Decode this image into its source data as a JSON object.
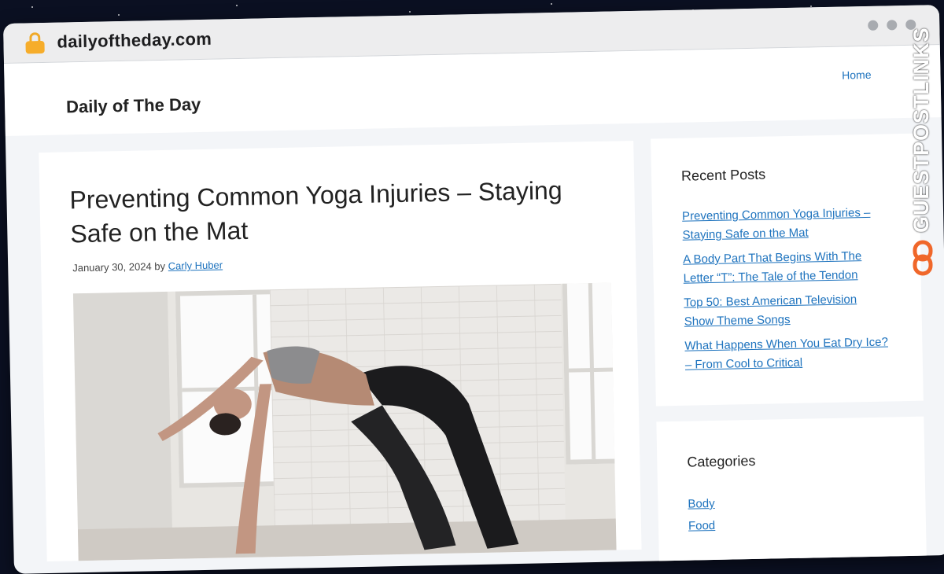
{
  "browser": {
    "url": "dailyoftheday.com"
  },
  "header": {
    "site_title": "Daily of The Day",
    "nav_home": "Home"
  },
  "article": {
    "title": "Preventing Common Yoga Injuries – Staying Safe on the Mat",
    "date": "January 30, 2024",
    "by": "by",
    "author": "Carly Huber"
  },
  "sidebar": {
    "recent_title": "Recent Posts",
    "recent_posts": [
      "Preventing Common Yoga Injuries – Staying Safe on the Mat",
      "A Body Part That Begins With The Letter “T”: The Tale of the Tendon",
      "Top 50: Best American Television Show Theme Songs",
      "What Happens When You Eat Dry Ice? – From Cool to Critical"
    ],
    "categories_title": "Categories",
    "categories": [
      "Body",
      "Food"
    ]
  },
  "watermark": {
    "text": "GUESTPOSTLINKS"
  },
  "colors": {
    "link": "#1e73be",
    "lock": "#f6ad2b",
    "badge_icon": "#f0672a"
  },
  "icons": [
    "lock-icon",
    "window-dots-icon",
    "link-chain-icon"
  ]
}
